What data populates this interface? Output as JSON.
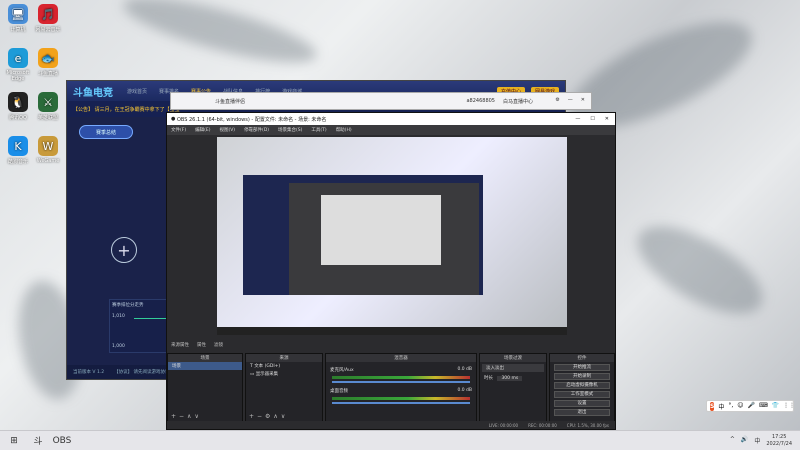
{
  "desktop": {
    "icons": [
      {
        "label": "计算机",
        "glyph": "🖥",
        "color": "#4a8fd8"
      },
      {
        "label": "网易云音乐",
        "glyph": "🎵",
        "color": "#d8242f"
      },
      {
        "label": "Microsoft Edge",
        "glyph": "e",
        "color": "#1d9bd8"
      },
      {
        "label": "斗鱼直播",
        "glyph": "🐟",
        "color": "#f2a21b"
      },
      {
        "label": "腾讯QQ",
        "glyph": "🐧",
        "color": "#222"
      },
      {
        "label": "英雄联盟",
        "glyph": "⚔",
        "color": "#2a6b3a"
      },
      {
        "label": "酷狗音乐",
        "glyph": "K",
        "color": "#1a8ee8"
      },
      {
        "label": "WeGame",
        "glyph": "W",
        "color": "#c89a3a"
      }
    ]
  },
  "back_window": {
    "logo": "斗鱼电竞",
    "tabs": [
      "游戏首页",
      "赛事排名",
      "赛事公告",
      "战队信息",
      "排行榜",
      "游戏商城"
    ],
    "active_tab_index": 2,
    "buttons": [
      "充值中心",
      "网易游戏"
    ],
    "notice": "【公告】 请三月，在王冠争霸赛中拿下了【宝宝",
    "season_badge": "赛季总结",
    "chart_title": "赛季排位分走势",
    "chart_values": [
      "1,010",
      "1,000"
    ],
    "footer": [
      "当前版本 V 1.2",
      "【协议】 请先阅读游戏协议"
    ]
  },
  "mid_window": {
    "title": "斗鱼直播伴侣",
    "user": "a82468805",
    "account": "白马直播中心"
  },
  "obs": {
    "title": "OBS 26.1.1 (64-bit, windows) - 配置文件: 未命名 - 场景: 未命名",
    "menu": [
      "文件(F)",
      "编辑(E)",
      "视图(V)",
      "停靠部件(D)",
      "场景集合(S)",
      "工具(T)",
      "帮助(H)"
    ],
    "preview_toolbar": [
      "来源属性",
      "属性",
      "滤镜"
    ],
    "docks": {
      "scenes": {
        "title": "场景",
        "items": [
          "场景"
        ]
      },
      "sources": {
        "title": "来源",
        "items": [
          "文本 (GDI+)",
          "显示器采集"
        ]
      },
      "mixer": {
        "title": "混音器",
        "channels": [
          {
            "name": "麦克风/Aux",
            "db": "0.0 dB"
          },
          {
            "name": "桌面音频",
            "db": "0.0 dB"
          }
        ]
      },
      "transitions": {
        "title": "场景过渡",
        "type": "淡入淡出",
        "duration_label": "时长",
        "duration": "300 ms"
      },
      "controls": {
        "title": "控件",
        "buttons": [
          "开始推流",
          "开始录制",
          "启动虚拟摄像机",
          "工作室模式",
          "设置",
          "退出"
        ]
      }
    },
    "status": {
      "live": "LIVE: 00:00:00",
      "rec": "REC: 00:00:00",
      "cpu": "CPU: 1.5%, 30.00 fps"
    }
  },
  "ime": {
    "label": "S",
    "items": [
      "中",
      "°,",
      "☺",
      "🎤",
      "⌨",
      "👕",
      "⋮⋮"
    ]
  },
  "taskbar": {
    "apps": [
      "⊞",
      "斗",
      "OBS"
    ],
    "tray_items": [
      "^",
      "🔊",
      "中"
    ],
    "time": "17:25",
    "date": "2022/7/24"
  },
  "colors": {
    "accent": "#3d5a8a",
    "obs_bg": "#2b2b2e",
    "brand_yellow": "#e8b21f"
  }
}
